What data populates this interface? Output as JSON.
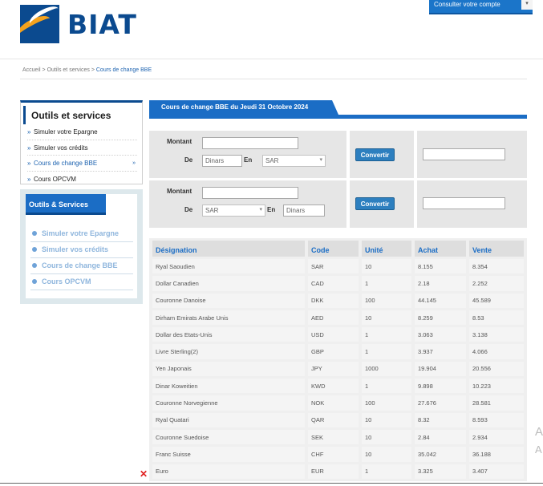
{
  "header": {
    "logo_text": "BIAT",
    "account_button": "Consulter votre compte",
    "account_caret": "▾"
  },
  "breadcrumb": {
    "home": "Accueil",
    "separator": ">",
    "section": "Outils et services",
    "current": "Cours de change BBE"
  },
  "sidebar": {
    "title": "Outils et services",
    "items": [
      {
        "label": "Simuler votre Epargne"
      },
      {
        "label": "Simuler vos crédits"
      },
      {
        "label": "Cours de change BBE"
      },
      {
        "label": "Cours OPCVM"
      }
    ],
    "bullet": "»",
    "active_indicator": "»"
  },
  "services_box": {
    "title": "Outils & Services",
    "items": [
      {
        "label": "Simuler votre Epargne"
      },
      {
        "label": "Simuler vos crédits"
      },
      {
        "label": "Cours de change BBE"
      },
      {
        "label": "Cours OPCVM"
      }
    ]
  },
  "main": {
    "tab_title": "Cours de change BBE du Jeudi 31 Octobre 2024",
    "converter1": {
      "montant_label": "Montant",
      "de_label": "De",
      "en_label": "En",
      "from_value": "Dinars",
      "to_value": "SAR",
      "button": "Convertir",
      "result": ""
    },
    "converter2": {
      "montant_label": "Montant",
      "de_label": "De",
      "en_label": "En",
      "from_value": "SAR",
      "to_value": "Dinars",
      "button": "Convertir",
      "result": ""
    },
    "table": {
      "headers": [
        "Désignation",
        "Code",
        "Unité",
        "Achat",
        "Vente"
      ],
      "rows": [
        [
          "Ryal Saoudien",
          "SAR",
          "10",
          "8.155",
          "8.354"
        ],
        [
          "Dollar Canadien",
          "CAD",
          "1",
          "2.18",
          "2.252"
        ],
        [
          "Couronne Danoise",
          "DKK",
          "100",
          "44.145",
          "45.589"
        ],
        [
          "Dirham Emirats Arabe Unis",
          "AED",
          "10",
          "8.259",
          "8.53"
        ],
        [
          "Dollar des Etats-Unis",
          "USD",
          "1",
          "3.063",
          "3.138"
        ],
        [
          "Livre Sterling(2)",
          "GBP",
          "1",
          "3.937",
          "4.066"
        ],
        [
          "Yen Japonais",
          "JPY",
          "1000",
          "19.904",
          "20.556"
        ],
        [
          "Dinar Koweitien",
          "KWD",
          "1",
          "9.898",
          "10.223"
        ],
        [
          "Couronne Norvegienne",
          "NOK",
          "100",
          "27.676",
          "28.581"
        ],
        [
          "Ryal Quatari",
          "QAR",
          "10",
          "8.32",
          "8.593"
        ],
        [
          "Couronne Suedoise",
          "SEK",
          "10",
          "2.84",
          "2.934"
        ],
        [
          "Franc Suisse",
          "CHF",
          "10",
          "35.042",
          "36.188"
        ],
        [
          "Euro",
          "EUR",
          "1",
          "3.325",
          "3.407"
        ]
      ]
    }
  },
  "icons": {
    "close_mark": "✕",
    "select_arrow": "▾"
  },
  "edge_text": [
    "A",
    "A"
  ]
}
